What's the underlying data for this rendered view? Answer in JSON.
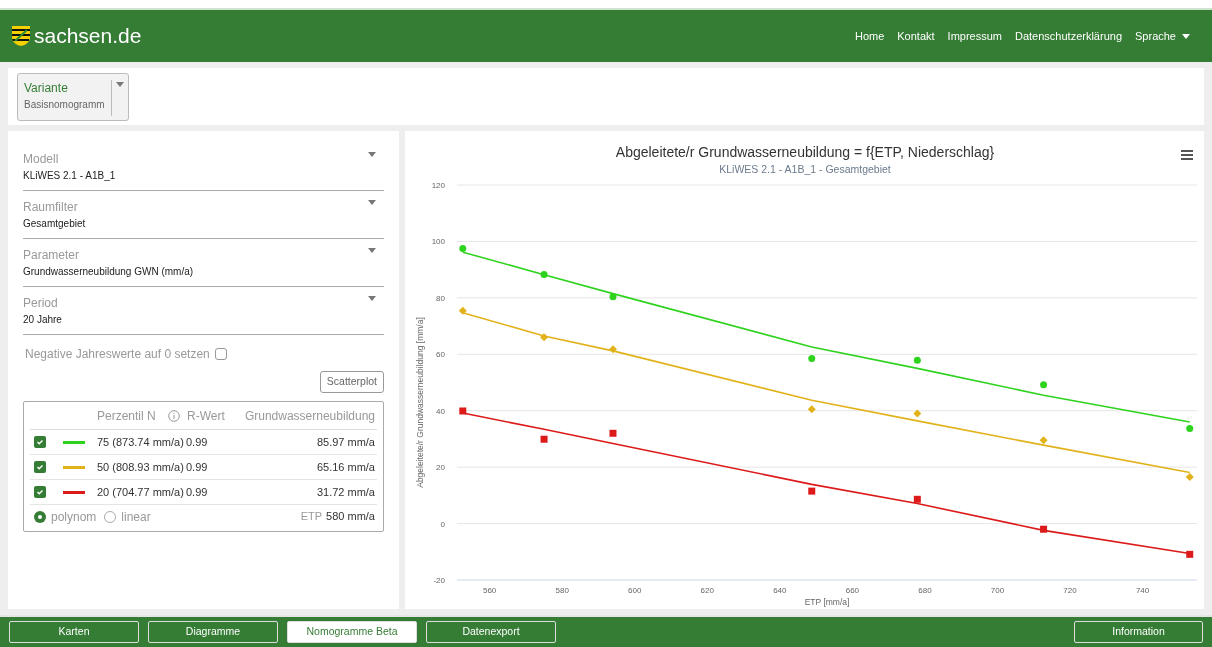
{
  "header": {
    "logo_text": "sachsen.de",
    "nav": [
      "Home",
      "Kontakt",
      "Impressum",
      "Datenschutzerklärung"
    ],
    "language_menu": "Sprache"
  },
  "variant": {
    "label": "Variante",
    "value": "Basisnomogramm"
  },
  "filters": [
    {
      "label": "Modell",
      "value": "KLiWES 2.1 - A1B_1"
    },
    {
      "label": "Raumfilter",
      "value": "Gesamtgebiet"
    },
    {
      "label": "Parameter",
      "value": "Grundwasserneubildung GWN (mm/a)"
    },
    {
      "label": "Period",
      "value": "20 Jahre"
    }
  ],
  "negative_option": {
    "label": "Negative Jahreswerte auf 0 setzen",
    "checked": false
  },
  "scatterplot_button": "Scatterplot",
  "percentile_table": {
    "columns": [
      "Perzentil N",
      "R-Wert",
      "Grundwasserneubildung"
    ],
    "rows": [
      {
        "checked": true,
        "color": "#2ed31e",
        "percentile": "75 (873.74 mm/a)",
        "r_value": "0.99",
        "recharge": "85.97 mm/a"
      },
      {
        "checked": true,
        "color": "#e2b21a",
        "percentile": "50 (808.93 mm/a)",
        "r_value": "0.99",
        "recharge": "65.16 mm/a"
      },
      {
        "checked": true,
        "color": "#dd1a1a",
        "percentile": "20 (704.77 mm/a)",
        "r_value": "0.99",
        "recharge": "31.72 mm/a"
      }
    ],
    "fit_options": [
      {
        "label": "polynom",
        "selected": true
      },
      {
        "label": "linear",
        "selected": false
      }
    ],
    "etp": {
      "label": "ETP",
      "value": "580 mm/a"
    }
  },
  "chart": {
    "chart_data": {
      "type": "scatter",
      "title": "Abgeleitete/r Grundwasserneubildung = f{ETP, Niederschlag}",
      "subtitle": "KLiWES 2.1 - A1B_1 - Gesamtgebiet",
      "xlabel": "ETP [mm/a]",
      "ylabel": "Abgeleitete/r Grundwasserneubildung [mm/a]",
      "x": [
        552.6,
        575,
        594,
        648.8,
        677.9,
        712.7,
        753
      ],
      "grid": true,
      "xlim": [
        551,
        755
      ],
      "ylim": [
        -20,
        120
      ],
      "xticks": [
        560,
        580,
        600,
        620,
        640,
        660,
        680,
        700,
        720,
        740
      ],
      "yticks": [
        -20,
        0,
        20,
        40,
        60,
        80,
        100,
        120
      ],
      "series": [
        {
          "type": "scatter",
          "marker": "circle",
          "color": "#2ed31e",
          "values": [
            97.5,
            88.3,
            80.4,
            58.5,
            57.9,
            49.2,
            33.7
          ]
        },
        {
          "type": "scatter",
          "marker": "diamond",
          "color": "#e2b21a",
          "values": [
            75.4,
            66,
            61.8,
            40.5,
            39,
            29.5,
            16.5
          ]
        },
        {
          "type": "scatter",
          "marker": "square",
          "color": "#dd1a1a",
          "values": [
            39.9,
            29.9,
            32,
            11.5,
            8.6,
            -2,
            -10.9
          ]
        },
        {
          "type": "line",
          "color": "#2ed31e",
          "values": [
            96.2,
            88.2,
            81.5,
            62.6,
            55,
            45.5,
            36
          ]
        },
        {
          "type": "line",
          "color": "#e2b21a",
          "values": [
            74.7,
            66.5,
            61.2,
            43.7,
            36.4,
            27.8,
            18.1
          ]
        },
        {
          "type": "line",
          "color": "#dd1a1a",
          "values": [
            39.2,
            33.4,
            28.4,
            13.9,
            7.1,
            -2.4,
            -10.6
          ]
        }
      ]
    }
  },
  "footer_tabs": [
    {
      "label": "Karten",
      "selected": false
    },
    {
      "label": "Diagramme",
      "selected": false
    },
    {
      "label": "Nomogramme Beta",
      "selected": true
    },
    {
      "label": "Datenexport",
      "selected": false
    }
  ],
  "info_button": "Information"
}
